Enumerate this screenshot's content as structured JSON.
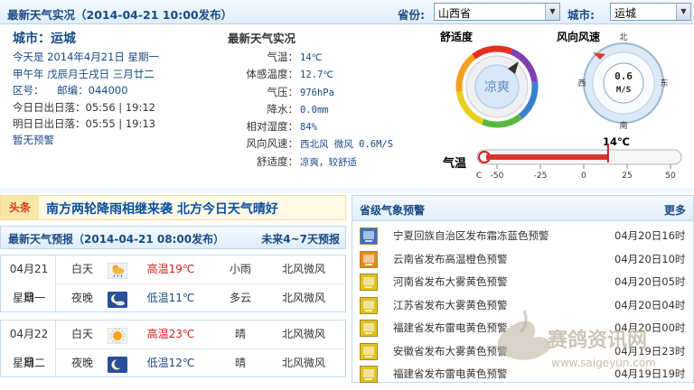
{
  "header": {
    "title": "最新天气实况（2014-04-21 10:00发布）",
    "province_label": "省份:",
    "province_value": "山西省",
    "city_label": "城市:",
    "city_value": "运城"
  },
  "city_info": {
    "city": "城市：运城",
    "today": "今天是",
    "today_val": "2014年4月21日 星期一",
    "lunar": "甲午年 戊辰月壬戌日 三月廿二",
    "area_code_label": "区号：",
    "postcode_label": "邮编：",
    "postcode": "044000",
    "today_sun_label": "今日日出日落：",
    "today_sun": "05:56 | 19:12",
    "tomorrow_sun_label": "明日日出日落：",
    "tomorrow_sun": "05:55 | 19:13",
    "warning": "暂无预警"
  },
  "live": {
    "title": "最新天气实况",
    "rows": [
      {
        "k": "气温：",
        "v": "14℃"
      },
      {
        "k": "体感温度：",
        "v": "12.7℃"
      },
      {
        "k": "气压：",
        "v": "976hPa"
      },
      {
        "k": "降水：",
        "v": "0.0mm"
      },
      {
        "k": "相对湿度：",
        "v": "84%"
      },
      {
        "k": "风向风速：",
        "v": "西北风 微风 0.6M/S"
      },
      {
        "k": "舒适度：",
        "v": "凉爽，较舒适"
      }
    ]
  },
  "gauges": {
    "comfort_label": "舒适度",
    "comfort_value": "凉爽",
    "wind_label": "风向风速",
    "wind_value": "0.6",
    "wind_unit": "M/S",
    "north": "北",
    "south": "南",
    "east": "东",
    "west": "西",
    "temp_label": "气温",
    "temp_value": "14℃",
    "temp_unit": "C",
    "temp_ticks": [
      "-50",
      "-25",
      "0",
      "25",
      "50"
    ],
    "temp_min": -50,
    "temp_max": 50,
    "temp_current": 14
  },
  "headline": {
    "tag": "头条",
    "text": "南方两轮降雨相继来袭  北方今日天气晴好"
  },
  "forecast": {
    "title": "最新天气预报（2014-04-21  08:00发布）",
    "more": "未来4~7天预报",
    "days": [
      {
        "date": "04月21日",
        "weekday": "星期一",
        "rows": [
          {
            "period": "白天",
            "icon": "light-rain-icon",
            "temp": "高温19℃",
            "weather": "小雨",
            "wind": "北风微风"
          },
          {
            "period": "夜晚",
            "icon": "moon-cloud-icon",
            "temp": "低温11℃",
            "weather": "多云",
            "wind": "北风微风"
          }
        ]
      },
      {
        "date": "04月22日",
        "weekday": "星期二",
        "rows": [
          {
            "period": "白天",
            "icon": "sun-icon",
            "temp": "高温23℃",
            "weather": "晴",
            "wind": "北风微风"
          },
          {
            "period": "夜晚",
            "icon": "moon-icon",
            "temp": "低温12℃",
            "weather": "晴",
            "wind": "北风微风"
          }
        ]
      }
    ]
  },
  "alerts": {
    "title": "省级气象预警",
    "more": "更多",
    "items": [
      {
        "icon": "frost-blue-warning-icon",
        "text": "宁夏回族自治区发布霜冻蓝色预警",
        "date": "04月20日16时",
        "color": "#3a6fc4"
      },
      {
        "icon": "heat-orange-warning-icon",
        "text": "云南省发布高温橙色预警",
        "date": "04月20日10时",
        "color": "#e88a1a"
      },
      {
        "icon": "fog-yellow-warning-icon",
        "text": "河南省发布大雾黄色预警",
        "date": "04月20日05时",
        "color": "#e2c21c"
      },
      {
        "icon": "fog-yellow-warning-icon",
        "text": "江苏省发布大雾黄色预警",
        "date": "04月20日04时",
        "color": "#e2c21c"
      },
      {
        "icon": "thunder-yellow-warning-icon",
        "text": "福建省发布雷电黄色预警",
        "date": "04月20日00时",
        "color": "#e2c21c"
      },
      {
        "icon": "fog-yellow-warning-icon",
        "text": "安徽省发布大雾黄色预警",
        "date": "04月19日23时",
        "color": "#e2c21c"
      },
      {
        "icon": "thunder-yellow-warning-icon",
        "text": "福建省发布雷电黄色预警",
        "date": "04月19日19时",
        "color": "#e2c21c"
      }
    ]
  },
  "watermark": {
    "text": "赛鸽资讯网",
    "url": "www.saigeyun.com"
  }
}
